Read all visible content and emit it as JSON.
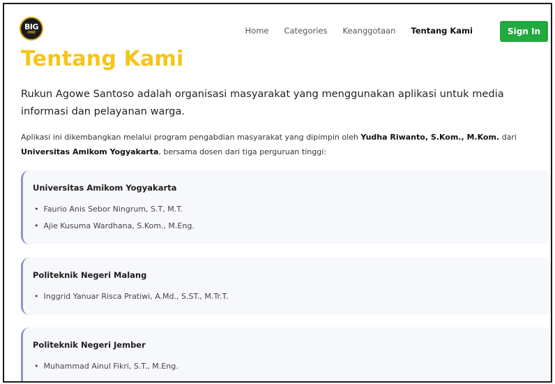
{
  "nav": {
    "logo_text": "BIG",
    "logo_sub": "ONE",
    "links": [
      "Home",
      "Categories",
      "Keanggotaan",
      "Tentang Kami"
    ],
    "signin_label": "Sign In"
  },
  "page": {
    "title": "Tentang Kami",
    "intro": "Rukun Agowe Santoso adalah organisasi masyarakat yang menggunakan aplikasi untuk media informasi dan pelayanan warga.",
    "desc_prefix": "Aplikasi ini dikembangkan melalui program pengabdian masyarakat yang dipimpin oleh ",
    "desc_leader": "Yudha Riwanto, S.Kom., M.Kom.",
    "desc_mid": " dari ",
    "desc_institution": "Universitas Amikom Yogyakarta",
    "desc_suffix": ", bersama dosen dari tiga perguruan tinggi:"
  },
  "institutions": [
    {
      "name": "Universitas Amikom Yogyakarta",
      "members": [
        "Faurio Anis Sebor Ningrum, S.T, M.T.",
        "Ajie Kusuma Wardhana, S.Kom., M.Eng."
      ]
    },
    {
      "name": "Politeknik Negeri Malang",
      "members": [
        "Inggrid Yanuar Risca Pratiwi, A.Md., S.ST., M.Tr.T."
      ]
    },
    {
      "name": "Politeknik Negeri Jember",
      "members": [
        "Muhammad Ainul Fikri, S.T., M.Eng."
      ]
    }
  ]
}
